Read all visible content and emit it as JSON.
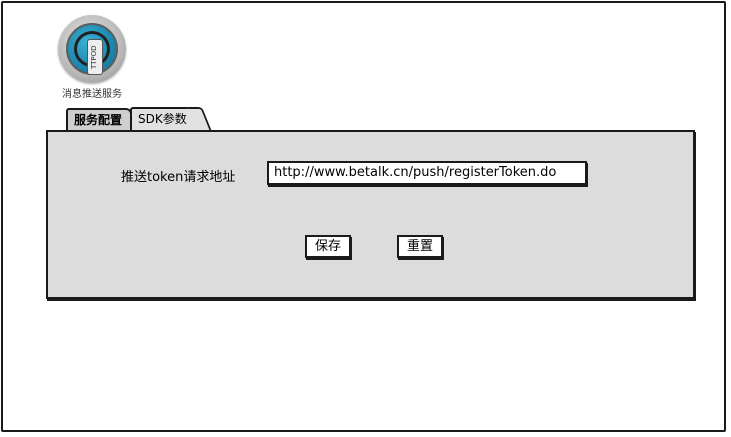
{
  "app": {
    "logo_icon": "ttpod-app-icon",
    "logo_text": "TTPOD",
    "name": "消息推送服务"
  },
  "tabs": [
    {
      "label": "服务配置",
      "active": false
    },
    {
      "label": "SDK参数",
      "active": true
    }
  ],
  "form": {
    "token_label": "推送token请求地址",
    "token_url": "http://www.betalk.cn/push/registerToken.do"
  },
  "actions": {
    "save_label": "保存",
    "reset_label": "重置"
  }
}
